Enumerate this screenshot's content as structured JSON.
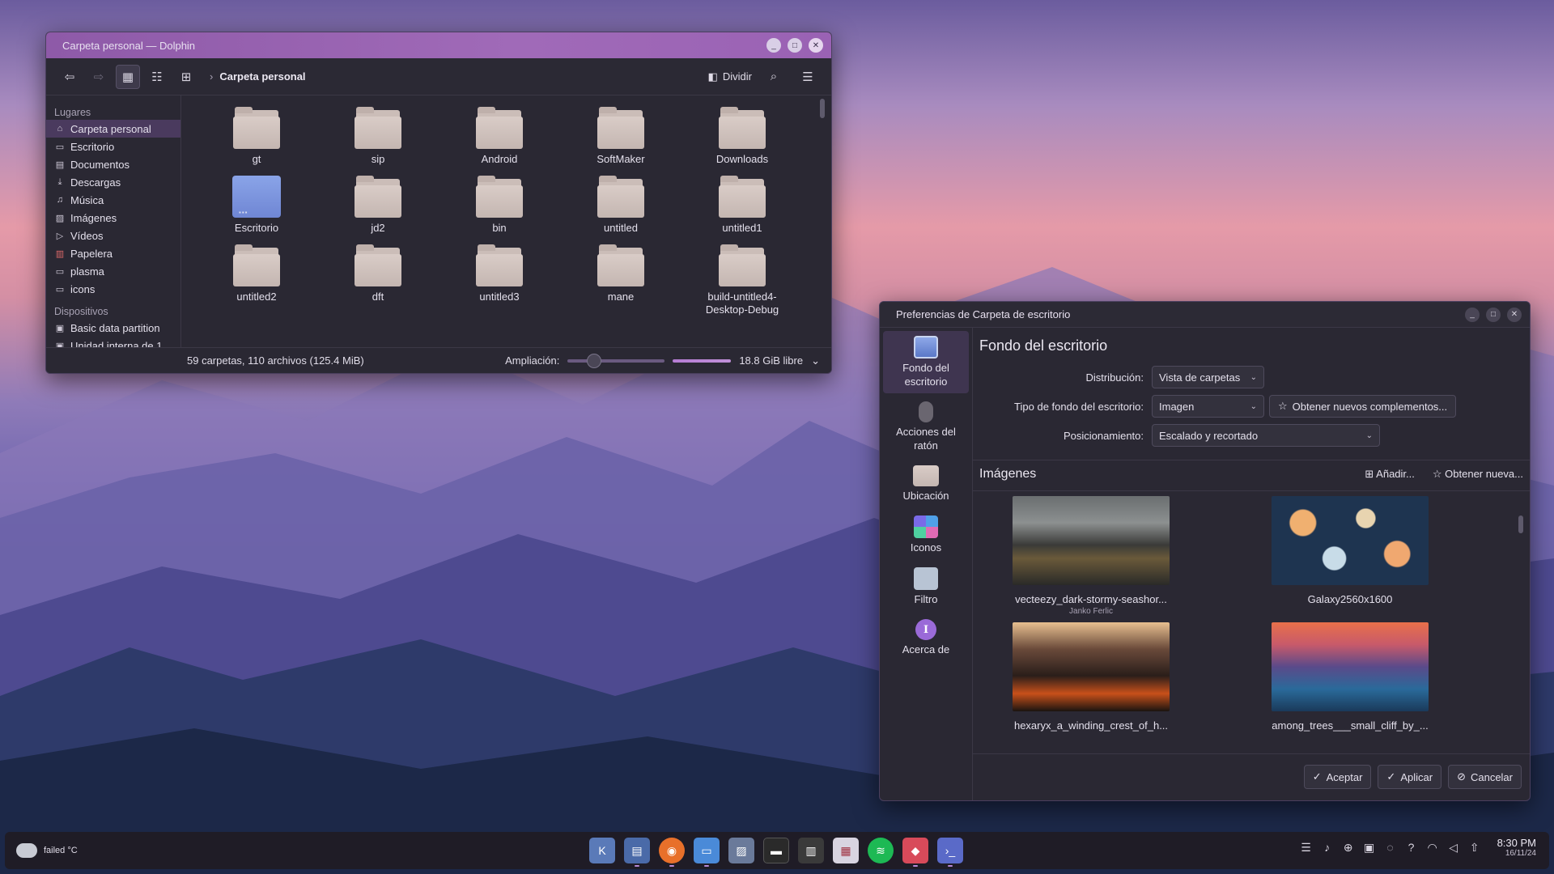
{
  "dolphin": {
    "title": "Carpeta personal — Dolphin",
    "breadcrumb": "Carpeta personal",
    "split_label": "Dividir",
    "places_header": "Lugares",
    "places": [
      {
        "label": "Carpeta personal",
        "icon": "home-icon"
      },
      {
        "label": "Escritorio",
        "icon": "monitor-icon"
      },
      {
        "label": "Documentos",
        "icon": "document-icon"
      },
      {
        "label": "Descargas",
        "icon": "download-icon"
      },
      {
        "label": "Música",
        "icon": "music-icon"
      },
      {
        "label": "Imágenes",
        "icon": "image-icon"
      },
      {
        "label": "Vídeos",
        "icon": "video-icon"
      },
      {
        "label": "Papelera",
        "icon": "trash-icon"
      },
      {
        "label": "plasma",
        "icon": "folder-icon"
      },
      {
        "label": "icons",
        "icon": "folder-icon"
      }
    ],
    "devices_header": "Dispositivos",
    "devices": [
      {
        "label": "Basic data partition",
        "icon": "drive-icon"
      },
      {
        "label": "Unidad interna de 1...",
        "icon": "drive-icon"
      }
    ],
    "files": [
      "gt",
      "sip",
      "Android",
      "SoftMaker",
      "Downloads",
      "Escritorio",
      "jd2",
      "bin",
      "untitled",
      "untitled1",
      "untitled2",
      "dft",
      "untitled3",
      "mane",
      "build-untitled4-Desktop-Debug"
    ],
    "status": "59 carpetas, 110 archivos (125.4 MiB)",
    "zoom_label": "Ampliación:",
    "free_space": "18.8 GiB libre"
  },
  "prefs": {
    "title": "Preferencias de Carpeta de escritorio",
    "categories": [
      {
        "label": "Fondo del escritorio",
        "icon": "wallpaper-icon"
      },
      {
        "label": "Acciones del ratón",
        "icon": "mouse-icon"
      },
      {
        "label": "Ubicación",
        "icon": "folder-icon"
      },
      {
        "label": "Iconos",
        "icon": "icons-icon"
      },
      {
        "label": "Filtro",
        "icon": "filter-icon"
      },
      {
        "label": "Acerca de",
        "icon": "about-icon"
      }
    ],
    "heading": "Fondo del escritorio",
    "layout_label": "Distribución:",
    "layout_value": "Vista de carpetas",
    "type_label": "Tipo de fondo del escritorio:",
    "type_value": "Imagen",
    "get_plugins": "Obtener nuevos complementos...",
    "positioning_label": "Posicionamiento:",
    "positioning_value": "Escalado y recortado",
    "images_heading": "Imágenes",
    "add_label": "Añadir...",
    "get_new_label": "Obtener nueva...",
    "images": [
      {
        "caption": "vecteezy_dark-stormy-seashor...",
        "author": "Janko Ferlic"
      },
      {
        "caption": "Galaxy2560x1600",
        "author": ""
      },
      {
        "caption": "hexaryx_a_winding_crest_of_h...",
        "author": ""
      },
      {
        "caption": "among_trees___small_cliff_by_...",
        "author": ""
      }
    ],
    "accept": "Aceptar",
    "apply": "Aplicar",
    "cancel": "Cancelar"
  },
  "taskbar": {
    "weather": "failed °C",
    "time": "8:30 PM",
    "date": "16/11/24"
  },
  "colors": {
    "accent": "#9a62b4",
    "window_bg": "#2a2833"
  }
}
